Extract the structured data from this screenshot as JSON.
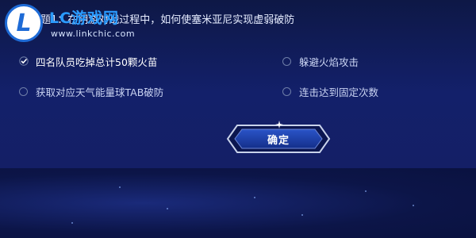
{
  "header": {
    "logo_letter": "L",
    "logo_text": "LC游戏网",
    "logo_url": "www.linkchic.com",
    "question": "选题1：在阴游对战过程中，如何使塞米亚尼实现虚弱破防"
  },
  "options": [
    {
      "label": "四名队员吃掉总计50颗火苗",
      "selected": true
    },
    {
      "label": "躲避火焰攻击",
      "selected": false
    },
    {
      "label": "获取对应天气能量球TAB破防",
      "selected": false
    },
    {
      "label": "连击达到固定次数",
      "selected": false
    }
  ],
  "confirm": {
    "label": "确定"
  },
  "colors": {
    "accent": "#2a9bff",
    "background": "#0f1a4a",
    "button": "#1a3a9a"
  }
}
